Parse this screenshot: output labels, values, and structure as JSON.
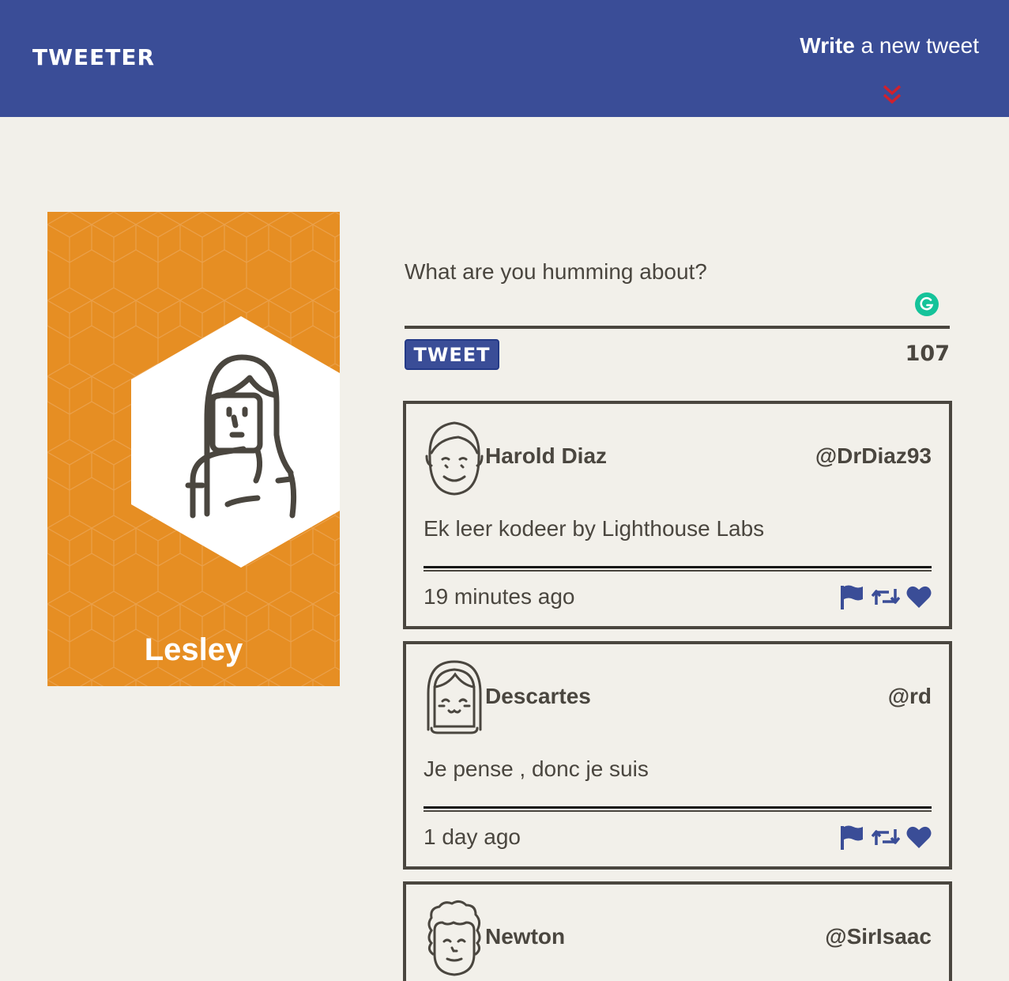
{
  "nav": {
    "brand": "TWEETER",
    "write_strong": "Write",
    "write_rest": " a new tweet",
    "accent_color": "#d0202d",
    "background": "#3a4d97"
  },
  "profile": {
    "name": "Lesley",
    "background": "#e68e23"
  },
  "compose": {
    "placeholder": "What are you humming about?",
    "button_label": "TWEET",
    "counter": "107"
  },
  "tweets": [
    {
      "name": "Harold Diaz",
      "handle": "@DrDiaz93",
      "content": "Ek leer kodeer by Lighthouse Labs",
      "time": "19 minutes ago",
      "avatar_icon": "male-avatar-icon"
    },
    {
      "name": "Descartes",
      "handle": "@rd",
      "content": "Je pense , donc je suis",
      "time": "1 day ago",
      "avatar_icon": "bangs-avatar-icon"
    },
    {
      "name": "Newton",
      "handle": "@SirIsaac",
      "content": "",
      "time": "",
      "avatar_icon": "curly-hair-avatar-icon"
    }
  ],
  "icons": {
    "flag": "flag-icon",
    "retweet": "retweet-icon",
    "like": "heart-icon",
    "action_color": "#3a4d97"
  }
}
